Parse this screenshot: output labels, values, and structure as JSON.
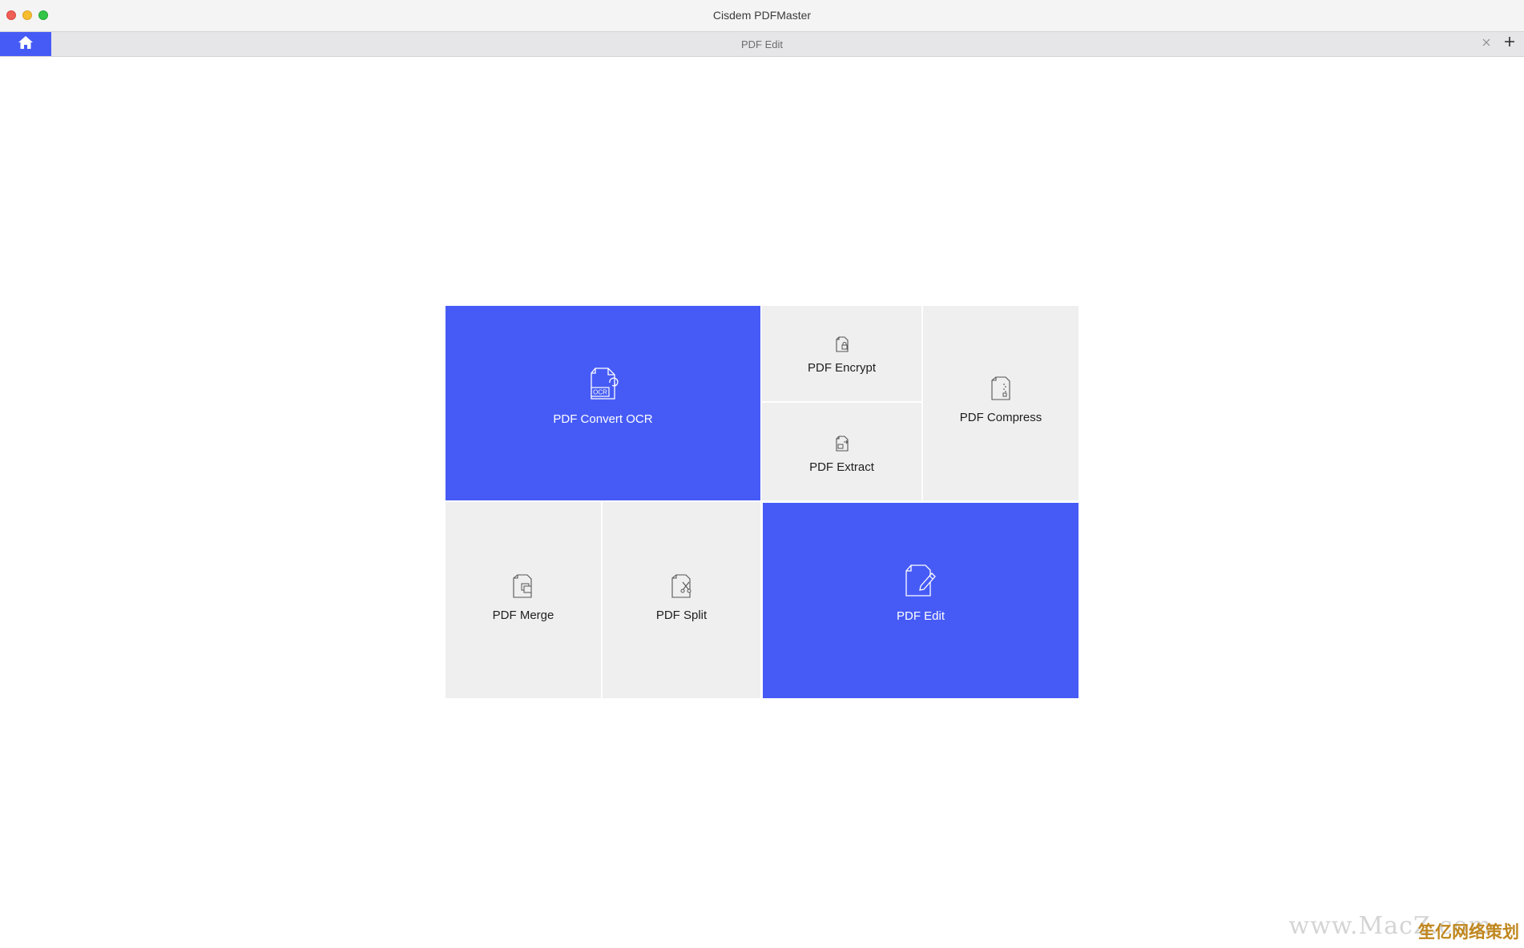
{
  "window": {
    "title": "Cisdem PDFMaster"
  },
  "tabbar": {
    "active_tab_title": "PDF Edit",
    "home_icon": "home-icon",
    "close_icon": "close-icon",
    "add_icon": "plus-icon"
  },
  "colors": {
    "accent": "#465bf6",
    "tile_bg": "#efefef",
    "titlebar": "#f4f4f5"
  },
  "tiles": {
    "ocr": {
      "label": "PDF Convert OCR",
      "icon": "pdf-ocr-icon",
      "icon_text": "OCR"
    },
    "encrypt": {
      "label": "PDF Encrypt",
      "icon": "pdf-encrypt-icon"
    },
    "compress": {
      "label": "PDF Compress",
      "icon": "pdf-compress-icon"
    },
    "extract": {
      "label": "PDF Extract",
      "icon": "pdf-extract-icon"
    },
    "merge": {
      "label": "PDF Merge",
      "icon": "pdf-merge-icon"
    },
    "split": {
      "label": "PDF Split",
      "icon": "pdf-split-icon"
    },
    "edit": {
      "label": "PDF Edit",
      "icon": "pdf-edit-icon"
    }
  },
  "watermark": {
    "text": "www.MacZ.com",
    "cn_text": "笙亿网络策划"
  }
}
